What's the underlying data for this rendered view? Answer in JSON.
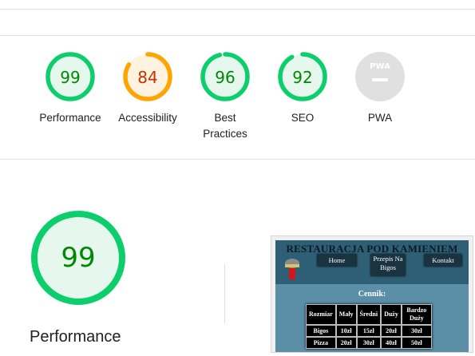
{
  "scores": [
    {
      "value": "99",
      "score": 0.99,
      "label": "Performance",
      "color": "#0cce6b",
      "bg": "#e6f8ee",
      "text": "#008800",
      "icon": "pass-gauge-icon"
    },
    {
      "value": "84",
      "score": 0.84,
      "label": "Accessibility",
      "color": "#ffa400",
      "bg": "#fff3e0",
      "text": "#c33300",
      "icon": "average-gauge-icon"
    },
    {
      "value": "96",
      "score": 0.96,
      "label": "Best Practices",
      "color": "#0cce6b",
      "bg": "#e6f8ee",
      "text": "#008800",
      "icon": "pass-gauge-icon"
    },
    {
      "value": "92",
      "score": 0.92,
      "label": "SEO",
      "color": "#0cce6b",
      "bg": "#e6f8ee",
      "text": "#008800",
      "icon": "pass-gauge-icon"
    },
    {
      "label": "PWA",
      "badge": "PWA",
      "icon": "pwa-badge-icon",
      "color": "#e0e0e0"
    }
  ],
  "main": {
    "value": "99",
    "score": 0.99,
    "label": "Performance",
    "color": "#0cce6b",
    "text": "#008800"
  },
  "screenshot": {
    "title": "RESTAURACJA POD KAMIENIEM",
    "nav": [
      "Home",
      "Przepis Na Bigos",
      "Kontakt"
    ],
    "subtitle": "Cennik:",
    "table": {
      "headers": [
        "Rozmiar",
        "Mały",
        "Średni",
        "Duży",
        "Bardzo Duży"
      ],
      "rows": [
        [
          "Bigos",
          "10zł",
          "15zł",
          "20zł",
          "30zł"
        ],
        [
          "Pizza",
          "20zł",
          "30zł",
          "40zł",
          "50zł"
        ]
      ]
    }
  }
}
